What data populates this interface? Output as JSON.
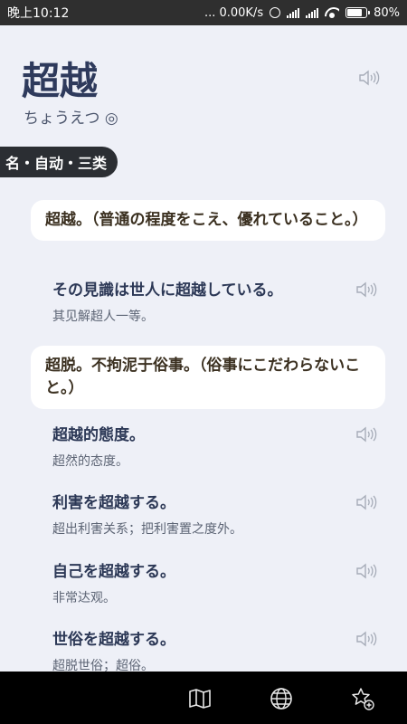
{
  "status_bar": {
    "time": "晚上10:12",
    "network_speed": "... 0.00K/s",
    "battery": "80%",
    "battery_level": 0.8
  },
  "entry": {
    "headword": "超越",
    "reading": "ちょうえつ ◎",
    "part_of_speech": "名・自动・三类"
  },
  "senses": [
    {
      "definition": "超越。（普通の程度をこえ、優れていること。）",
      "examples": [
        {
          "jp": "その見識は世人に超越している。",
          "cn": "其见解超人一等。"
        }
      ]
    },
    {
      "definition": "超脱。不拘泥于俗事。（俗事にこだわらないこと。）",
      "examples": [
        {
          "jp": "超越的態度。",
          "cn": "超然的态度。"
        },
        {
          "jp": "利害を超越する。",
          "cn": "超出利害关系；把利害置之度外。"
        },
        {
          "jp": "自己を超越する。",
          "cn": "非常达观。"
        },
        {
          "jp": "世俗を超越する。",
          "cn": "超脱世俗；超俗。"
        }
      ]
    }
  ],
  "icons": {
    "speaker": "speaker-icon",
    "map": "map-icon",
    "globe": "globe-icon",
    "favorite": "star-add-icon"
  },
  "colors": {
    "background": "#eef0f7",
    "headword": "#2e3a5c",
    "badge": "#2b2e33",
    "definition_text": "#3b3020"
  }
}
